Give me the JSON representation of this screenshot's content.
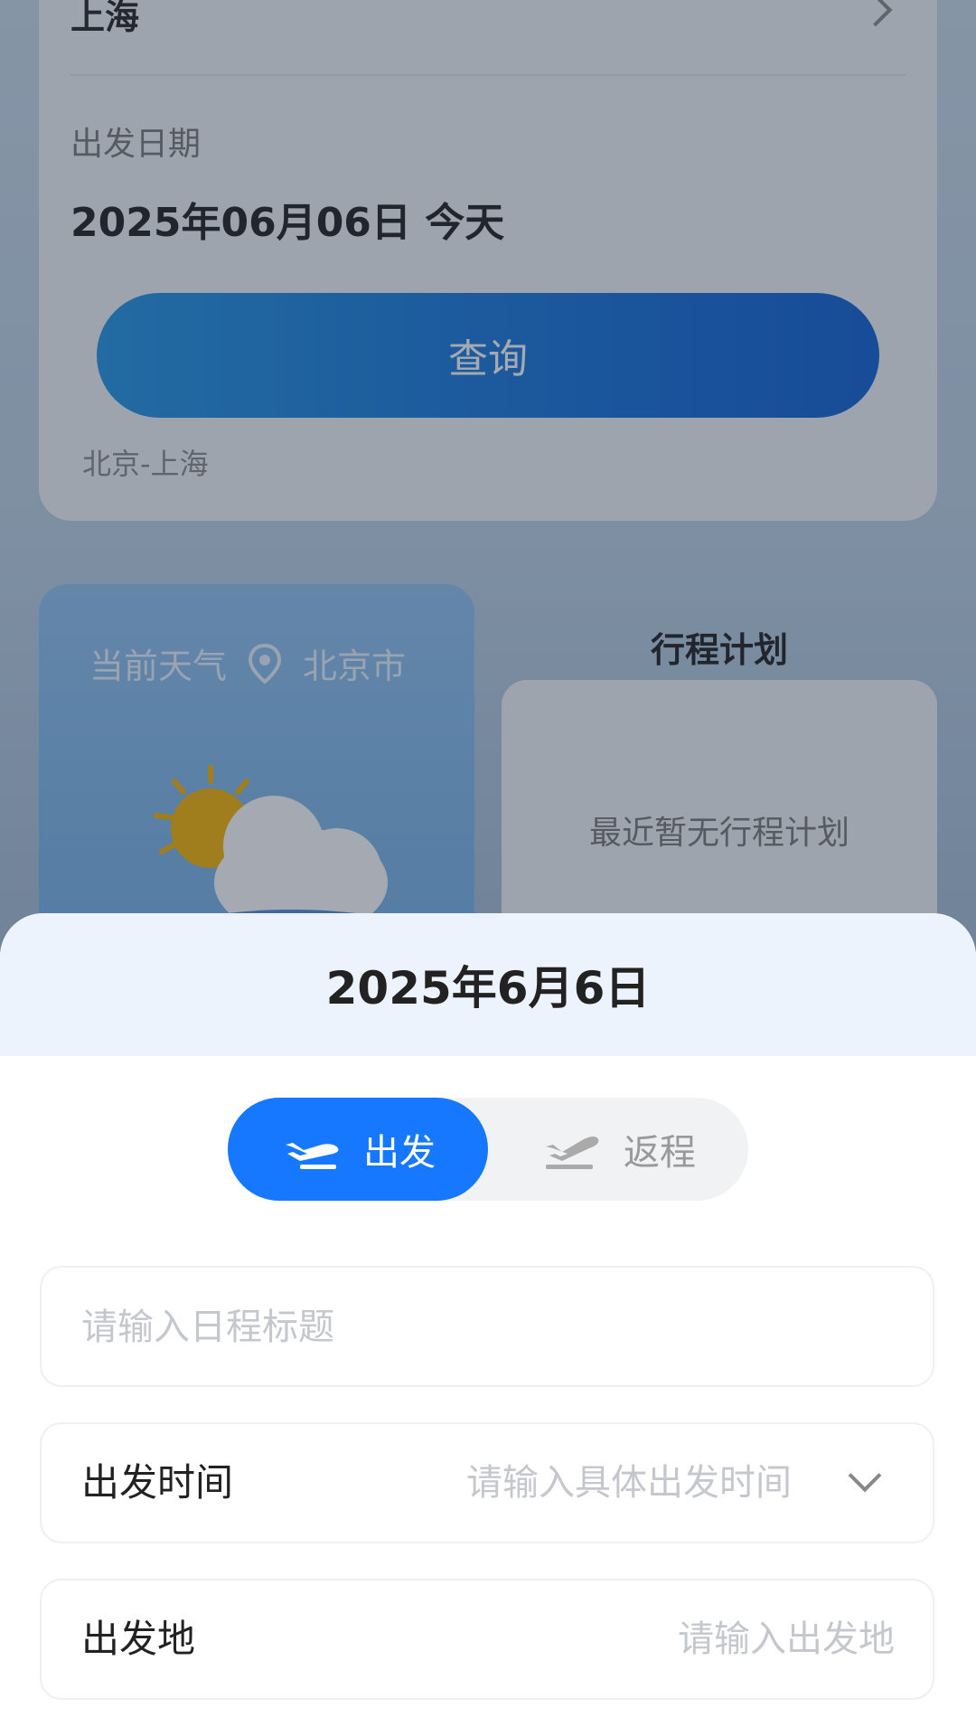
{
  "background": {
    "search": {
      "arrival_city": "上海",
      "date_label": "出发日期",
      "date_value": "2025年06月06日 今天",
      "query_button": "查询",
      "history_route": "北京-上海"
    },
    "weather": {
      "title": "当前天气",
      "location": "北京市",
      "icon": "sun-cloud-icon"
    },
    "plan": {
      "title": "行程计划",
      "empty_text": "最近暂无行程计划"
    }
  },
  "sheet": {
    "date": "2025年6月6日",
    "segment": {
      "depart_label": "出发",
      "return_label": "返程",
      "selected": "出发"
    },
    "title_field": {
      "value": "",
      "placeholder": "请输入日程标题"
    },
    "time_field": {
      "label": "出发时间",
      "placeholder": "请输入具体出发时间"
    },
    "origin_field": {
      "label": "出发地",
      "placeholder": "请输入出发地"
    }
  },
  "colors": {
    "accent": "#1677ff",
    "query_button": "#1377dc",
    "sheet_header": "#edf3fd"
  }
}
